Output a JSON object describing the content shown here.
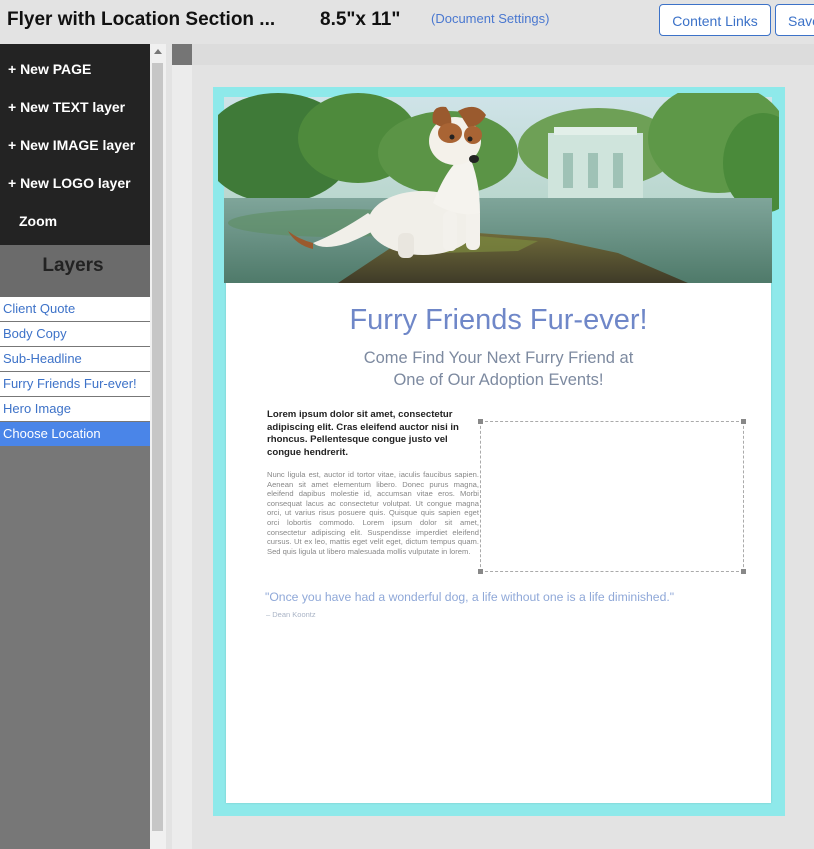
{
  "header": {
    "title": "Flyer with Location Section ...",
    "size": "8.5\"x 11\"",
    "settings_link": "(Document Settings)",
    "content_links_button": "Content Links",
    "save_button": "Save"
  },
  "sidebar": {
    "menu": [
      {
        "label": "+ New PAGE"
      },
      {
        "label": "+ New TEXT layer"
      },
      {
        "label": "+ New IMAGE layer"
      },
      {
        "label": "+ New LOGO layer"
      },
      {
        "label": "Zoom"
      }
    ],
    "layers_title": "Layers",
    "layers": [
      {
        "label": "Client Quote",
        "active": false
      },
      {
        "label": "Body Copy",
        "active": false
      },
      {
        "label": "Sub-Headline",
        "active": false
      },
      {
        "label": "Furry Friends Fur-ever!",
        "active": false
      },
      {
        "label": "Hero Image",
        "active": false
      },
      {
        "label": "Choose Location",
        "active": true
      }
    ]
  },
  "document": {
    "headline": "Furry Friends Fur-ever!",
    "subheadline_line1": "Come Find Your Next Furry Friend at",
    "subheadline_line2": "One of Our Adoption Events!",
    "lead": "Lorem ipsum dolor sit amet, consectetur adipiscing elit. Cras eleifend auctor nisi in rhoncus. Pellentesque congue justo vel congue hendrerit.",
    "body": "Nunc ligula est, auctor id tortor vitae, iaculis faucibus sapien. Aenean sit amet elementum libero. Donec purus magna, eleifend dapibus molestie id, accumsan vitae eros. Morbi consequat lacus ac consectetur volutpat. Ut congue magna orci, ut varius risus posuere quis. Quisque quis sapien eget orci lobortis commodo. Lorem ipsum dolor sit amet, consectetur adipiscing elit. Suspendisse imperdiet eleifend cursus. Ut ex leo, mattis eget velit eget, dictum tempus quam. Sed quis ligula ut libero malesuada mollis vulputate in lorem.",
    "quote": "\"Once you have had a wonderful dog, a life without one is a life diminished.\"",
    "quote_author": "– Dean Koontz"
  },
  "colors": {
    "accent": "#3c72c8",
    "active_layer": "#4a85e8",
    "bleed": "#8ee9ea",
    "headline": "#6f87c8"
  }
}
